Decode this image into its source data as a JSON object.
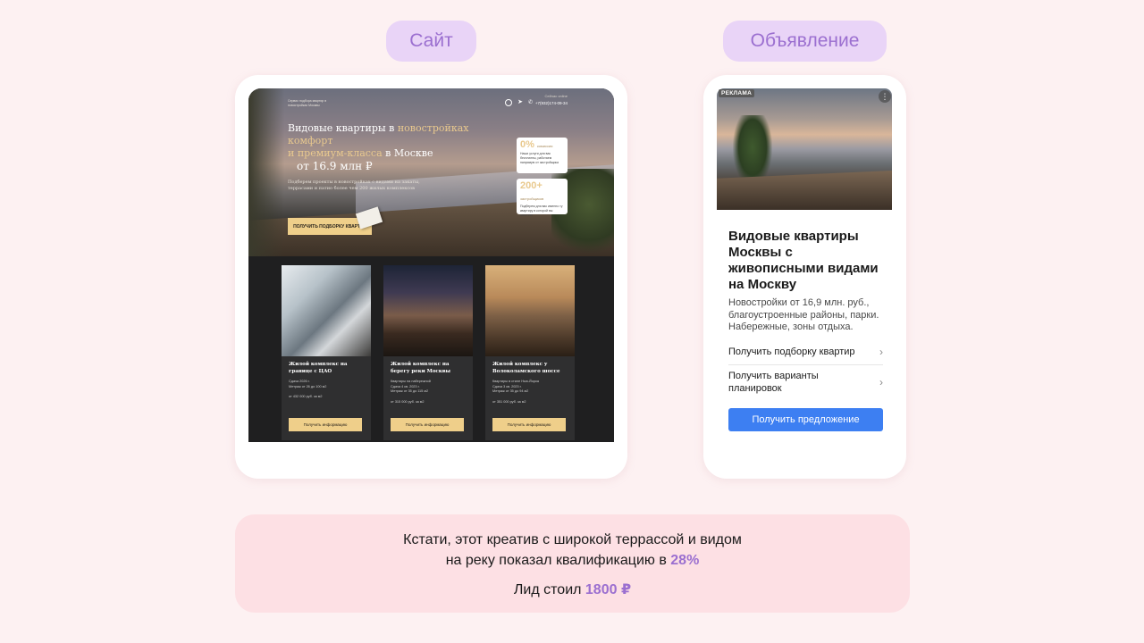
{
  "labels": {
    "site": "Сайт",
    "ad": "Объявление"
  },
  "site": {
    "brand": "Сервис подбора квартир в новостройках Москвы",
    "call_note": "Сейчас online",
    "phone": "+7(932)174-09-34",
    "hero": {
      "title_1": "Видовые квартиры в ",
      "title_gold_1": "новостройках",
      "title_gold_2": "комфорт",
      "title_gold_3": "и премиум-класса",
      "title_2": " в Москве",
      "price": "от 16.9 млн ₽",
      "subtitle": "Подберем проекты в новостройках с видами на закаты, террасами и патио более чем 200 жилых комплексов",
      "cta": "ПОЛУЧИТЬ ПОДБОРКУ КВАРТИР"
    },
    "stats": [
      {
        "big": "0%",
        "small": "комиссия",
        "text": "Наши услуги для вас бесплатны, работаем напрямую от застройщика"
      },
      {
        "big": "200+",
        "small": "застройщиков",
        "text": "Подберем для вас именно ту квартиру в которой вы захотите"
      }
    ],
    "projects": [
      {
        "title": "Жилой комплекс на границе с ЦАО",
        "meta_1": "Сдача 2026 г.",
        "meta_2": "Метраж от 26 до 100 м2",
        "price": "от 432 000 руб. за м2",
        "button": "Получить информацию"
      },
      {
        "title": "Жилой комплекс на берегу реки Москвы",
        "meta_1": "Квартиры на набережной",
        "meta_2": "Сдача 4 кв. 2023 г.",
        "meta_3": "Метраж от 35 до 115 м2",
        "price": "от 315 000 руб. за м2",
        "button": "Получить информацию"
      },
      {
        "title": "Жилой комплекс у Волоколамского шоссе",
        "meta_1": "Квартиры в стиле Нью-Йорка",
        "meta_2": "Сдача 3 кв. 2023 г.",
        "meta_3": "Метраж от 35 до 94 м2",
        "price": "от 351 000 руб. за м2",
        "button": "Получить информацию"
      }
    ]
  },
  "ad": {
    "badge": "РЕКЛАМА",
    "title": "Видовые квартиры Москвы с живописными видами на Москву",
    "description": "Новостройки от 16,9 млн. руб., благоустроенные районы, парки. Набережные, зоны отдыха.",
    "links": [
      "Получить подборку квартир",
      "Получить варианты планировок"
    ],
    "button": "Получить предложение"
  },
  "note": {
    "line_1": "Кстати, этот креатив с широкой террассой и видом",
    "line_2_prefix": "на реку показал квалификацию в ",
    "line_2_value": "28%",
    "line_3_prefix": "Лид стоил ",
    "line_3_value": "1800 ₽"
  },
  "colors": {
    "accent": "#9b6fd0",
    "pill_bg": "#e9d4f7",
    "page_bg": "#fdf1f2",
    "note_bg": "#fde0e4",
    "gold": "#efcf8a",
    "ad_button": "#3d7ff2"
  }
}
